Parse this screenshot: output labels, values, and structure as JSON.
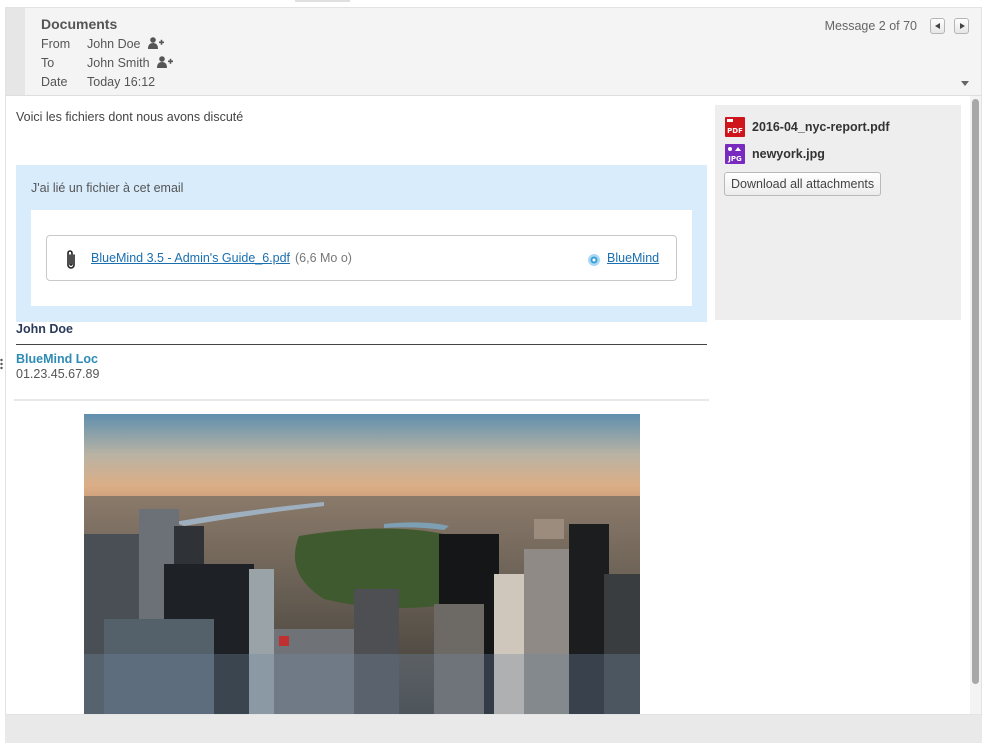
{
  "header": {
    "subject": "Documents",
    "from_label": "From",
    "from_value": "John Doe",
    "to_label": "To",
    "to_value": "John Smith",
    "date_label": "Date",
    "date_value": "Today 16:12",
    "message_counter": "Message 2 of 70",
    "icons": [
      "person-add-icon",
      "previous-arrow-icon",
      "next-arrow-icon",
      "collapse-chevron-icon"
    ]
  },
  "body": {
    "intro": "Voici les fichiers dont nous avons discuté"
  },
  "linked_attachment": {
    "intro": "J'ai lié un fichier à cet email",
    "file_name": "BlueMind 3.5 - Admin's Guide_6.pdf",
    "file_size": "(6,6 Mo o)",
    "provider": "BlueMind",
    "icons": [
      "paperclip-icon",
      "bluemind-logo-icon"
    ]
  },
  "signature": {
    "name": "John Doe",
    "company": "BlueMind Loc",
    "phone": "01.23.45.67.89"
  },
  "attachments_panel": {
    "items": [
      {
        "name": "2016-04_nyc-report.pdf",
        "icon": "pdf-file-icon"
      },
      {
        "name": "newyork.jpg",
        "icon": "jpg-file-icon"
      }
    ],
    "download_all_label": "Download all attachments"
  },
  "colors": {
    "link": "#1a6fb0",
    "attachment_box_bg": "#d8ecfc",
    "signature_company": "#2e8bb5",
    "pdf_icon": "#d0141b",
    "jpg_icon": "#7a2bbf"
  }
}
